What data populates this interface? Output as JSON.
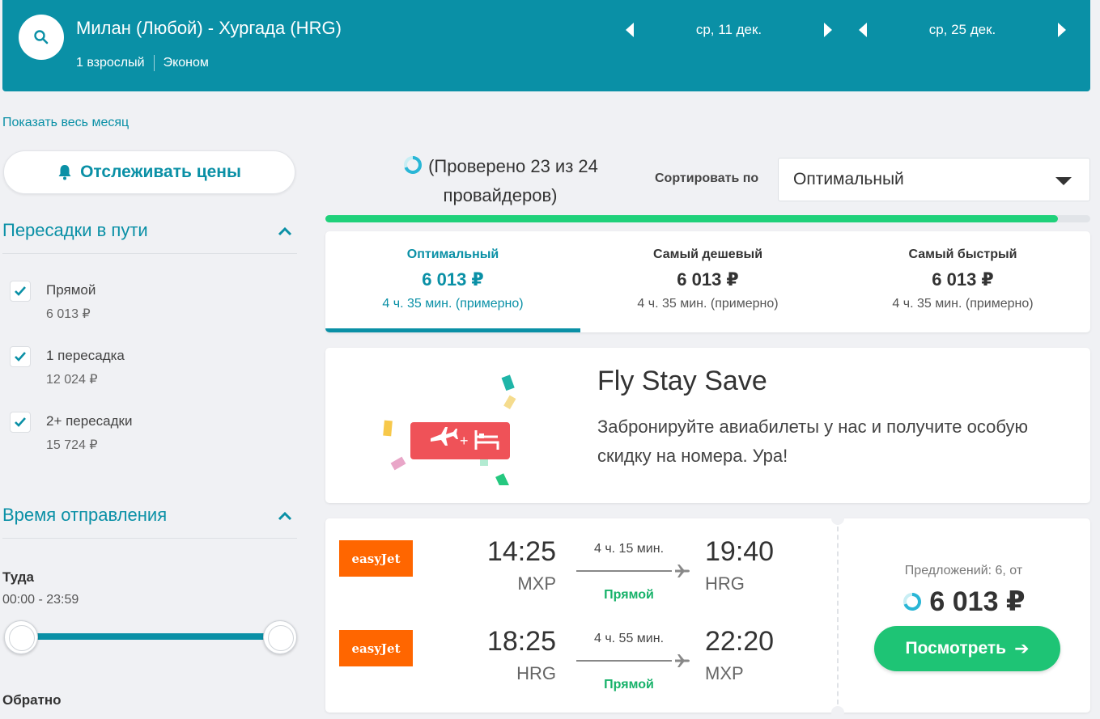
{
  "header": {
    "route": "Милан (Любой) - Хургада (HRG)",
    "passengers": "1 взрослый",
    "cabin": "Эконом",
    "depart_date": "ср, 11 дек.",
    "return_date": "ср, 25 дек."
  },
  "left": {
    "show_month": "Показать весь месяц",
    "track_prices": "Отслеживать цены",
    "stops_title": "Пересадки в пути",
    "stops": [
      {
        "label": "Прямой",
        "price": "6 013 ₽",
        "checked": true
      },
      {
        "label": "1 пересадка",
        "price": "12 024 ₽",
        "checked": true
      },
      {
        "label": "2+ пересадки",
        "price": "15 724 ₽",
        "checked": true
      }
    ],
    "departure_title": "Время отправления",
    "outbound_label": "Туда",
    "outbound_range": "00:00 - 23:59",
    "return_label": "Обратно"
  },
  "progress": {
    "text": "(Проверено 23 из 24 провайдеров)",
    "fraction": 0.958
  },
  "sort": {
    "label": "Сортировать по",
    "value": "Оптимальный"
  },
  "tabs": [
    {
      "label": "Оптимальный",
      "price": "6 013 ₽",
      "duration": "4 ч. 35 мин. (примерно)",
      "active": true
    },
    {
      "label": "Самый дешевый",
      "price": "6 013 ₽",
      "duration": "4 ч. 35 мин. (примерно)",
      "active": false
    },
    {
      "label": "Самый быстрый",
      "price": "6 013 ₽",
      "duration": "4 ч. 35 мин. (примерно)",
      "active": false
    }
  ],
  "promo": {
    "title": "Fly Stay Save",
    "text": "Забронируйте авиабилеты у нас и получите особую скидку на номера. Ура!"
  },
  "flight": {
    "legs": [
      {
        "airline": "easyJet",
        "dep_time": "14:25",
        "dep_code": "MXP",
        "duration": "4 ч. 15 мин.",
        "stops": "Прямой",
        "arr_time": "19:40",
        "arr_code": "HRG"
      },
      {
        "airline": "easyJet",
        "dep_time": "18:25",
        "dep_code": "HRG",
        "duration": "4 ч. 55 мин.",
        "stops": "Прямой",
        "arr_time": "22:20",
        "arr_code": "MXP"
      }
    ],
    "offers": "Предложений: 6, от",
    "price": "6 013 ₽",
    "button": "Посмотреть"
  },
  "colors": {
    "brand": "#0a90a6",
    "accent_green": "#1ec475",
    "progress_green": "#1fd17a",
    "airline_orange": "#ff6600"
  },
  "icons": [
    "search-icon",
    "bell-icon",
    "chevron-up-icon",
    "check-icon",
    "spinner-icon",
    "plane-icon",
    "bed-icon",
    "arrow-right-icon"
  ]
}
